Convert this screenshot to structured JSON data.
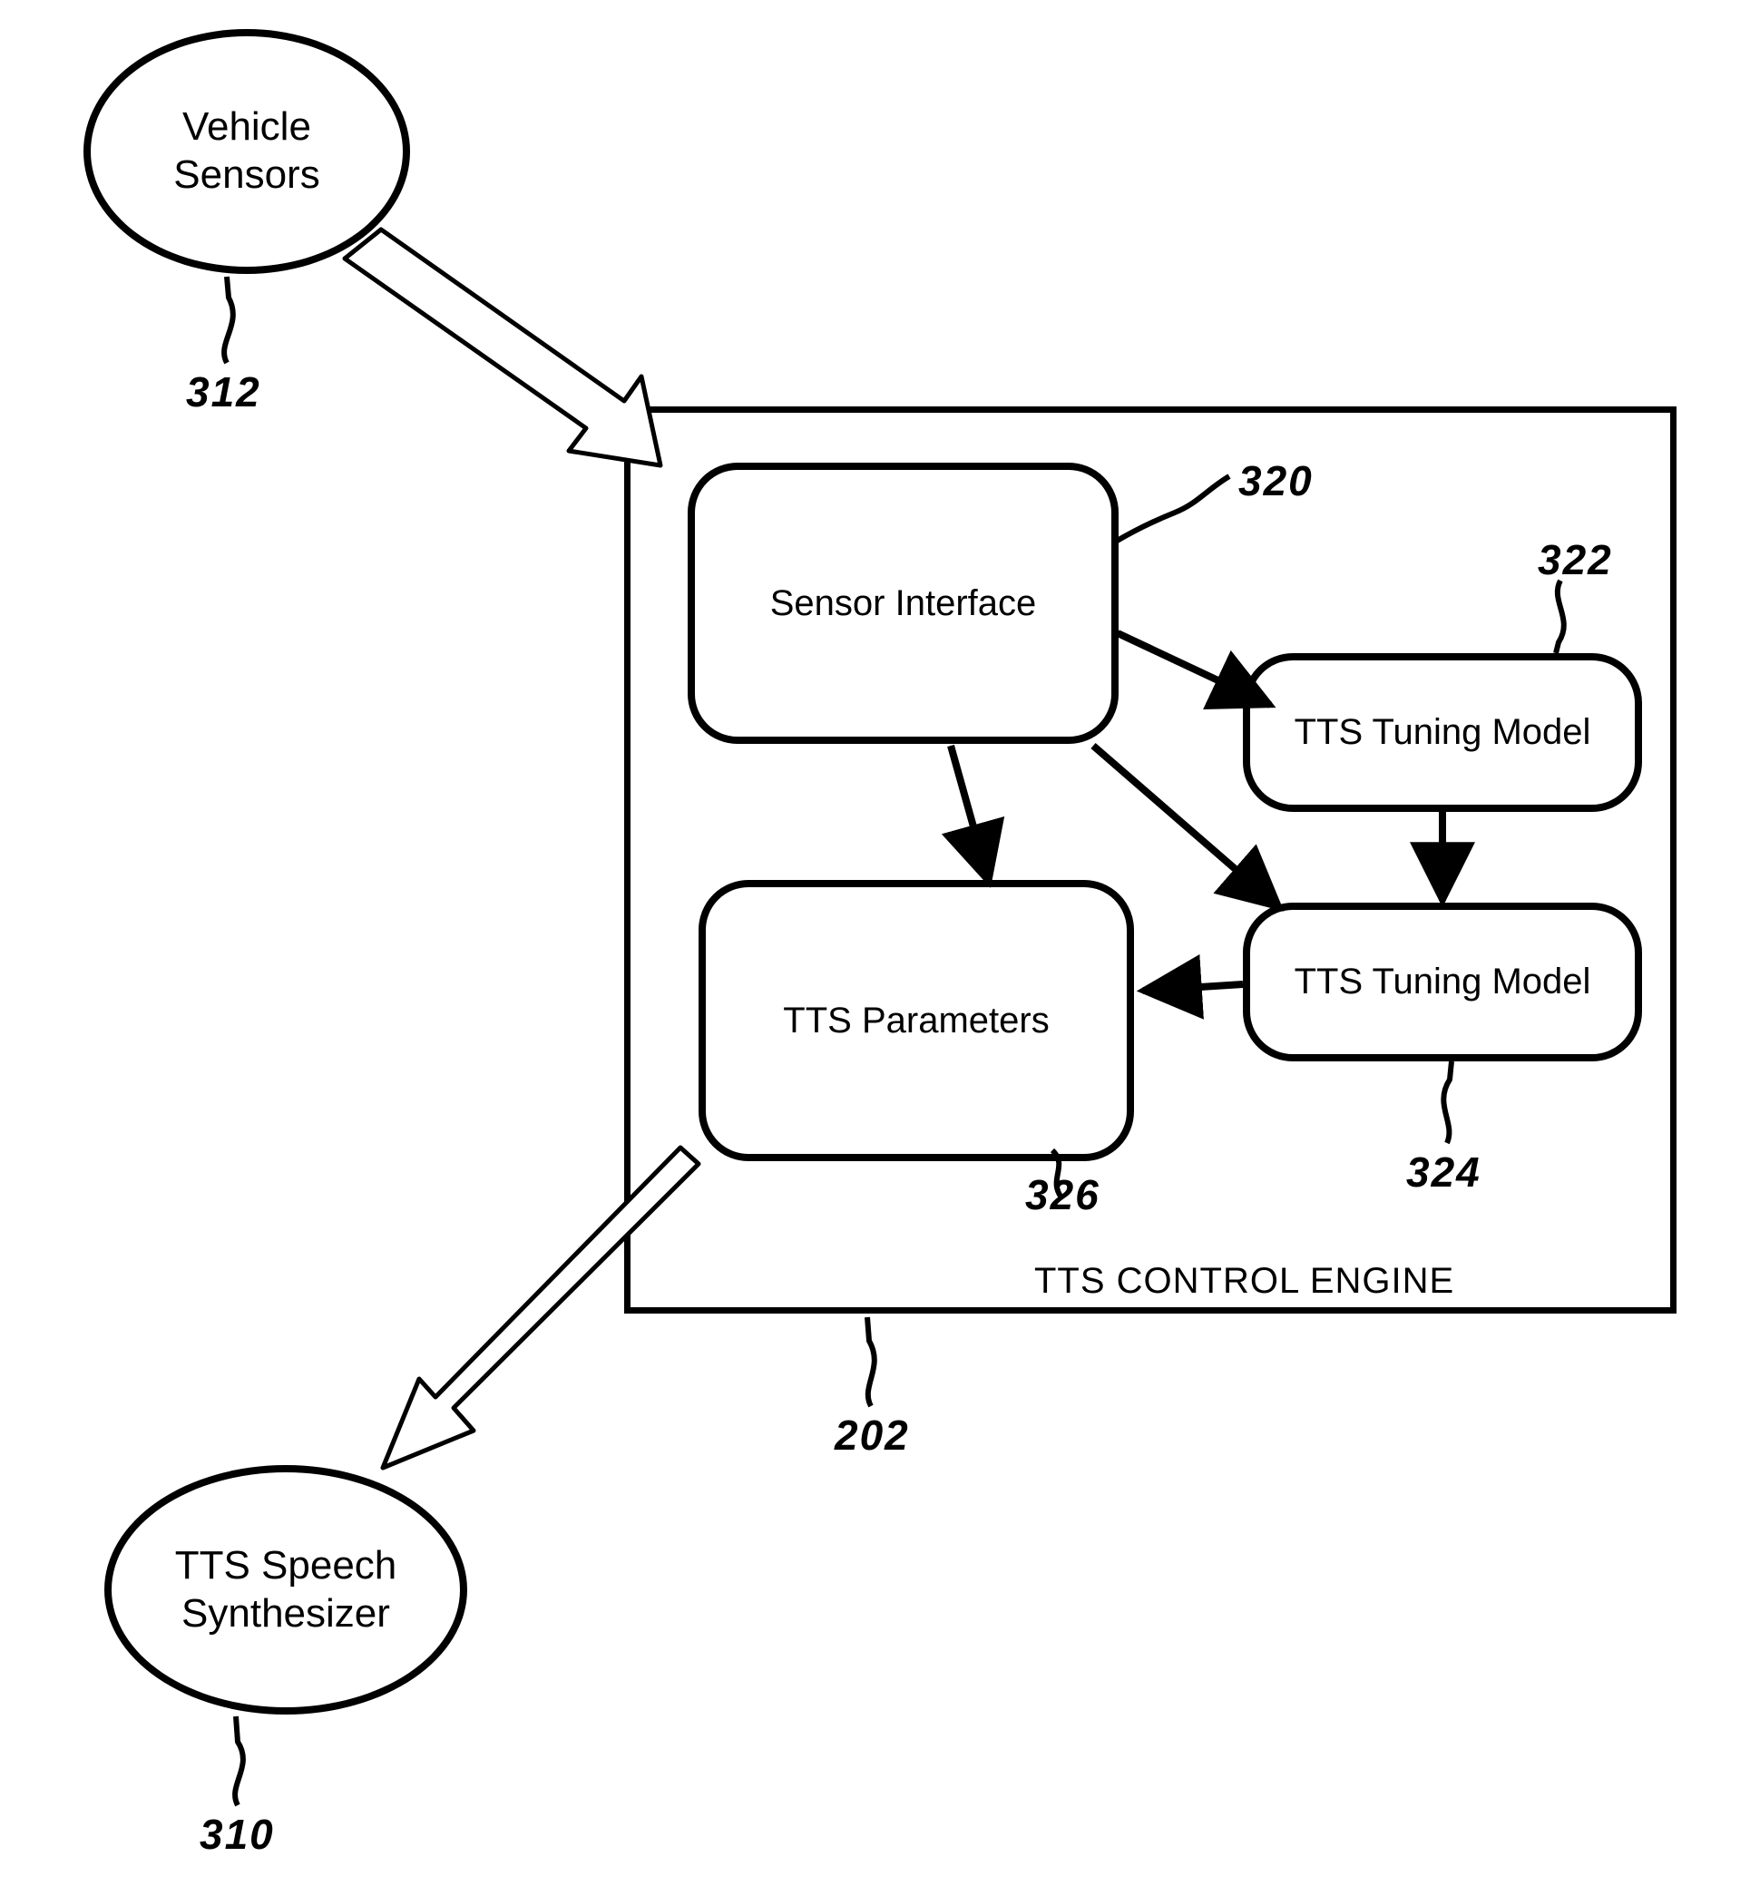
{
  "nodes": {
    "vehicle_sensors": "Vehicle\nSensors",
    "tts_synth": "TTS Speech\nSynthesizer",
    "engine_title": "TTS CONTROL ENGINE",
    "sensor_interface": "Sensor Interface",
    "tuning_model_a": "TTS Tuning Model",
    "tuning_model_b": "TTS Tuning Model",
    "tts_parameters": "TTS Parameters"
  },
  "refs": {
    "r312": "312",
    "r320": "320",
    "r322": "322",
    "r324": "324",
    "r326": "326",
    "r202": "202",
    "r310": "310"
  }
}
